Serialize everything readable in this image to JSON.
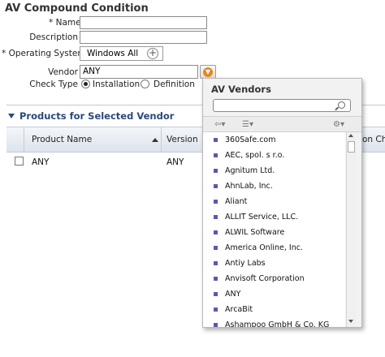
{
  "page": {
    "title": "AV Compound Condition"
  },
  "form": {
    "name_label": "* Name",
    "description_label": "Description",
    "os_label": "* Operating System",
    "os_value": "Windows All",
    "vendor_label": "Vendor",
    "vendor_value": "ANY",
    "check_type_label": "Check Type",
    "installation_label": "Installation",
    "definition_label": "Definition"
  },
  "products": {
    "section_title": "Products for Selected Vendor",
    "columns": [
      "Product Name",
      "Version",
      "on Ch"
    ],
    "rows": [
      {
        "product": "ANY",
        "version": "ANY"
      }
    ]
  },
  "vendor_popup": {
    "title": "AV Vendors",
    "search_value": "",
    "items": [
      "360Safe.com",
      "AEC, spol. s r.o.",
      "Agnitum Ltd.",
      "AhnLab, Inc.",
      "Aliant",
      "ALLIT Service, LLC.",
      "ALWIL Software",
      "America Online, Inc.",
      "Antiy Labs",
      "Anvisoft Corporation",
      "ANY",
      "ArcaBit",
      "Ashampoo GmbH & Co. KG"
    ]
  },
  "icons": {
    "os_add": "plus-circle-icon",
    "vendor_select": "dropdown-circle-icon",
    "search": "search-icon",
    "back": "back-arrow-icon",
    "list_view": "list-view-icon",
    "settings": "gear-icon"
  }
}
